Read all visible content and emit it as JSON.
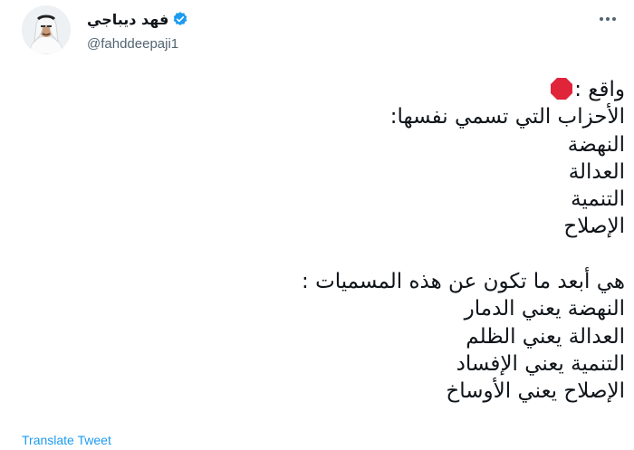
{
  "author": {
    "display_name": "فهد ديباجي",
    "handle": "@fahddeepaji1",
    "verified": true
  },
  "icons": {
    "verified": "verified-badge-icon",
    "more": "more-options-icon",
    "stop": "stop-sign-icon"
  },
  "colors": {
    "accent": "#1d9bf0",
    "stop_sign": "#e0243a",
    "secondary_text": "#536471"
  },
  "tweet": {
    "headline": "واقع :",
    "lines": [
      "الأحزاب التي تسمي نفسها:",
      "النهضة",
      "العدالة",
      "التنمية",
      "الإصلاح",
      "",
      "هي أبعد ما تكون عن هذه المسميات :",
      "النهضة يعني الدمار",
      "العدالة يعني الظلم",
      "التنمية يعني الإفساد",
      "الإصلاح يعني الأوساخ"
    ]
  },
  "actions": {
    "translate_label": "Translate Tweet"
  }
}
